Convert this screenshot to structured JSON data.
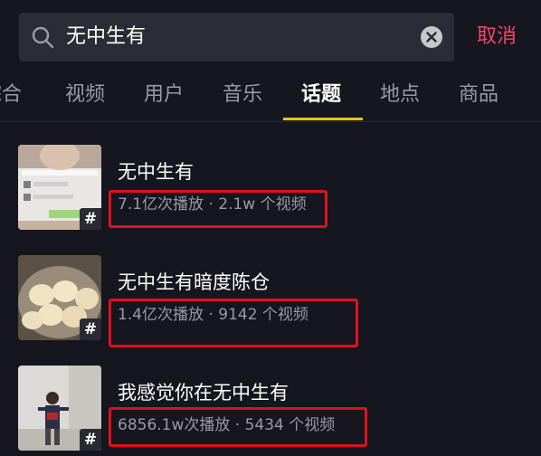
{
  "search": {
    "query": "无中生有",
    "cancel_label": "取消"
  },
  "tabs": [
    {
      "label": "综合"
    },
    {
      "label": "视频"
    },
    {
      "label": "用户"
    },
    {
      "label": "音乐"
    },
    {
      "label": "话题",
      "active": true
    },
    {
      "label": "地点"
    },
    {
      "label": "商品"
    }
  ],
  "results": [
    {
      "title": "无中生有",
      "meta": "7.1亿次播放 · 2.1w 个视频",
      "badge": "#"
    },
    {
      "title": "无中生有暗度陈仓",
      "meta": "1.4亿次播放 · 9142 个视频",
      "badge": "#"
    },
    {
      "title": "我感觉你在无中生有",
      "meta": "6856.1w次播放 · 5434 个视频",
      "badge": "#"
    }
  ],
  "colors": {
    "background": "#16161f",
    "accent_cancel": "#f1476b",
    "tab_indicator": "#f2c40c",
    "annotation_box": "#e0111b"
  }
}
